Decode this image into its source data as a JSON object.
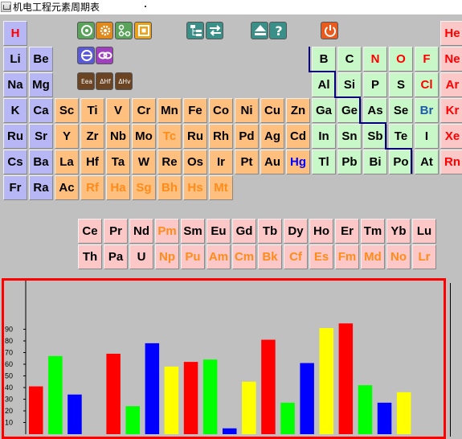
{
  "window": {
    "title": "机电工程元素周期表"
  },
  "toolbar": [
    {
      "name": "settings-button",
      "icon": "target-icon",
      "bg": "#5aa35a",
      "fg": "#ffffff"
    },
    {
      "name": "cycle-button",
      "icon": "cogs-icon",
      "bg": "#e08a1e",
      "fg": "#ffffff"
    },
    {
      "name": "network-button",
      "icon": "nodes-icon",
      "bg": "#5aa35a",
      "fg": "#ffffff"
    },
    {
      "name": "frame-button",
      "icon": "square-frame-icon",
      "bg": "#e8a21e",
      "fg": "#ffffff"
    },
    {
      "name": "layout-button",
      "icon": "tree-layout-icon",
      "bg": "#3a8f88",
      "fg": "#ffffff"
    },
    {
      "name": "swap-button",
      "icon": "swap-arrows-icon",
      "bg": "#3a8f88",
      "fg": "#ffffff"
    },
    {
      "name": "eject-button",
      "icon": "eject-icon",
      "bg": "#3a8f88",
      "fg": "#ffffff"
    },
    {
      "name": "help-button",
      "icon": "question-icon",
      "bg": "#3a8f88",
      "fg": "#ffffff"
    },
    {
      "name": "power-button",
      "icon": "power-icon",
      "bg": "#e85a1e",
      "fg": "#ffffff"
    },
    {
      "name": "refresh-button",
      "icon": "refresh-icon",
      "bg": "#5a5ad8",
      "fg": "#ffffff"
    },
    {
      "name": "link-button",
      "icon": "chain-link-icon",
      "bg": "#a040c0",
      "fg": "#ffffff"
    },
    {
      "name": "electron-affinity-button",
      "icon": "energy-icon",
      "bg": "#7a4a20",
      "fg": "#ffffff",
      "label": "Eea"
    },
    {
      "name": "delta-hf-button",
      "icon": "delta-h-icon",
      "bg": "#7a4a20",
      "fg": "#ffffff",
      "label": "ΔHf"
    },
    {
      "name": "delta-hv-button",
      "icon": "delta-h-icon",
      "bg": "#7a4a20",
      "fg": "#ffffff",
      "label": "ΔHv"
    }
  ],
  "elements": [
    {
      "symbol": "H",
      "bg": "blue",
      "color": "red"
    },
    {
      "symbol": "He",
      "bg": "pink",
      "color": "red"
    },
    {
      "symbol": "Li",
      "bg": "blue",
      "color": "black"
    },
    {
      "symbol": "Be",
      "bg": "blue",
      "color": "black"
    },
    {
      "symbol": "B",
      "bg": "green",
      "color": "black"
    },
    {
      "symbol": "C",
      "bg": "green",
      "color": "black"
    },
    {
      "symbol": "N",
      "bg": "green",
      "color": "red"
    },
    {
      "symbol": "O",
      "bg": "green",
      "color": "red"
    },
    {
      "symbol": "F",
      "bg": "green",
      "color": "red"
    },
    {
      "symbol": "Ne",
      "bg": "pink",
      "color": "red"
    },
    {
      "symbol": "Na",
      "bg": "blue",
      "color": "black"
    },
    {
      "symbol": "Mg",
      "bg": "blue",
      "color": "black"
    },
    {
      "symbol": "Al",
      "bg": "green",
      "color": "black"
    },
    {
      "symbol": "Si",
      "bg": "green",
      "color": "black"
    },
    {
      "symbol": "P",
      "bg": "green",
      "color": "black"
    },
    {
      "symbol": "S",
      "bg": "green",
      "color": "black"
    },
    {
      "symbol": "Cl",
      "bg": "green",
      "color": "red"
    },
    {
      "symbol": "Ar",
      "bg": "pink",
      "color": "red"
    },
    {
      "symbol": "K",
      "bg": "blue",
      "color": "black"
    },
    {
      "symbol": "Ca",
      "bg": "blue",
      "color": "black"
    },
    {
      "symbol": "Sc",
      "bg": "orange",
      "color": "black"
    },
    {
      "symbol": "Ti",
      "bg": "orange",
      "color": "black"
    },
    {
      "symbol": "V",
      "bg": "orange",
      "color": "black"
    },
    {
      "symbol": "Cr",
      "bg": "orange",
      "color": "black"
    },
    {
      "symbol": "Mn",
      "bg": "orange",
      "color": "black"
    },
    {
      "symbol": "Fe",
      "bg": "orange",
      "color": "black"
    },
    {
      "symbol": "Co",
      "bg": "orange",
      "color": "black"
    },
    {
      "symbol": "Ni",
      "bg": "orange",
      "color": "black"
    },
    {
      "symbol": "Cu",
      "bg": "orange",
      "color": "black"
    },
    {
      "symbol": "Zn",
      "bg": "orange",
      "color": "black"
    },
    {
      "symbol": "Ga",
      "bg": "green",
      "color": "black"
    },
    {
      "symbol": "Ge",
      "bg": "green",
      "color": "black"
    },
    {
      "symbol": "As",
      "bg": "green",
      "color": "black"
    },
    {
      "symbol": "Se",
      "bg": "green",
      "color": "black"
    },
    {
      "symbol": "Br",
      "bg": "green",
      "color": "navy"
    },
    {
      "symbol": "Kr",
      "bg": "pink",
      "color": "red"
    },
    {
      "symbol": "Ru",
      "bg": "blue",
      "color": "black"
    },
    {
      "symbol": "Sr",
      "bg": "blue",
      "color": "black"
    },
    {
      "symbol": "Y",
      "bg": "orange",
      "color": "black"
    },
    {
      "symbol": "Zr",
      "bg": "orange",
      "color": "black"
    },
    {
      "symbol": "Nb",
      "bg": "orange",
      "color": "black"
    },
    {
      "symbol": "Mo",
      "bg": "orange",
      "color": "black"
    },
    {
      "symbol": "Tc",
      "bg": "orange",
      "color": "orange"
    },
    {
      "symbol": "Ru",
      "bg": "orange",
      "color": "black"
    },
    {
      "symbol": "Rh",
      "bg": "orange",
      "color": "black"
    },
    {
      "symbol": "Pd",
      "bg": "orange",
      "color": "black"
    },
    {
      "symbol": "Ag",
      "bg": "orange",
      "color": "black"
    },
    {
      "symbol": "Cd",
      "bg": "orange",
      "color": "black"
    },
    {
      "symbol": "In",
      "bg": "green",
      "color": "black"
    },
    {
      "symbol": "Sn",
      "bg": "green",
      "color": "black"
    },
    {
      "symbol": "Sb",
      "bg": "green",
      "color": "black"
    },
    {
      "symbol": "Te",
      "bg": "green",
      "color": "black"
    },
    {
      "symbol": "I",
      "bg": "green",
      "color": "black"
    },
    {
      "symbol": "Xe",
      "bg": "pink",
      "color": "red"
    },
    {
      "symbol": "Cs",
      "bg": "blue",
      "color": "black"
    },
    {
      "symbol": "Ba",
      "bg": "blue",
      "color": "black"
    },
    {
      "symbol": "La",
      "bg": "orange",
      "color": "black"
    },
    {
      "symbol": "Hf",
      "bg": "orange",
      "color": "black"
    },
    {
      "symbol": "Ta",
      "bg": "orange",
      "color": "black"
    },
    {
      "symbol": "W",
      "bg": "orange",
      "color": "black"
    },
    {
      "symbol": "Re",
      "bg": "orange",
      "color": "black"
    },
    {
      "symbol": "Os",
      "bg": "orange",
      "color": "black"
    },
    {
      "symbol": "Ir",
      "bg": "orange",
      "color": "black"
    },
    {
      "symbol": "Pt",
      "bg": "orange",
      "color": "black"
    },
    {
      "symbol": "Au",
      "bg": "orange",
      "color": "black"
    },
    {
      "symbol": "Hg",
      "bg": "orange",
      "color": "blue"
    },
    {
      "symbol": "Tl",
      "bg": "green",
      "color": "black"
    },
    {
      "symbol": "Pb",
      "bg": "green",
      "color": "black"
    },
    {
      "symbol": "Bi",
      "bg": "green",
      "color": "black"
    },
    {
      "symbol": "Po",
      "bg": "green",
      "color": "black"
    },
    {
      "symbol": "At",
      "bg": "green",
      "color": "black"
    },
    {
      "symbol": "Rn",
      "bg": "pink",
      "color": "red"
    },
    {
      "symbol": "Fr",
      "bg": "blue",
      "color": "black"
    },
    {
      "symbol": "Ra",
      "bg": "blue",
      "color": "black"
    },
    {
      "symbol": "Ac",
      "bg": "orange",
      "color": "black"
    },
    {
      "symbol": "Rf",
      "bg": "orange",
      "color": "orange"
    },
    {
      "symbol": "Ha",
      "bg": "orange",
      "color": "orange"
    },
    {
      "symbol": "Sg",
      "bg": "orange",
      "color": "orange"
    },
    {
      "symbol": "Bh",
      "bg": "orange",
      "color": "orange"
    },
    {
      "symbol": "Hs",
      "bg": "orange",
      "color": "orange"
    },
    {
      "symbol": "Mt",
      "bg": "orange",
      "color": "orange"
    }
  ],
  "f_block": [
    {
      "symbol": "Ce",
      "bg": "pink",
      "color": "black"
    },
    {
      "symbol": "Pr",
      "bg": "pink",
      "color": "black"
    },
    {
      "symbol": "Nd",
      "bg": "pink",
      "color": "black"
    },
    {
      "symbol": "Pm",
      "bg": "pink",
      "color": "orange"
    },
    {
      "symbol": "Sm",
      "bg": "pink",
      "color": "black"
    },
    {
      "symbol": "Eu",
      "bg": "pink",
      "color": "black"
    },
    {
      "symbol": "Gd",
      "bg": "pink",
      "color": "black"
    },
    {
      "symbol": "Tb",
      "bg": "pink",
      "color": "black"
    },
    {
      "symbol": "Dy",
      "bg": "pink",
      "color": "black"
    },
    {
      "symbol": "Ho",
      "bg": "pink",
      "color": "black"
    },
    {
      "symbol": "Er",
      "bg": "pink",
      "color": "black"
    },
    {
      "symbol": "Tm",
      "bg": "pink",
      "color": "black"
    },
    {
      "symbol": "Yb",
      "bg": "pink",
      "color": "black"
    },
    {
      "symbol": "Lu",
      "bg": "pink",
      "color": "black"
    },
    {
      "symbol": "Th",
      "bg": "pink",
      "color": "black"
    },
    {
      "symbol": "Pa",
      "bg": "pink",
      "color": "black"
    },
    {
      "symbol": "U",
      "bg": "pink",
      "color": "black"
    },
    {
      "symbol": "Np",
      "bg": "pink",
      "color": "orange"
    },
    {
      "symbol": "Pu",
      "bg": "pink",
      "color": "orange"
    },
    {
      "symbol": "Am",
      "bg": "pink",
      "color": "orange"
    },
    {
      "symbol": "Cm",
      "bg": "pink",
      "color": "orange"
    },
    {
      "symbol": "Bk",
      "bg": "pink",
      "color": "orange"
    },
    {
      "symbol": "Cf",
      "bg": "pink",
      "color": "orange"
    },
    {
      "symbol": "Es",
      "bg": "pink",
      "color": "orange"
    },
    {
      "symbol": "Fm",
      "bg": "pink",
      "color": "orange"
    },
    {
      "symbol": "Md",
      "bg": "pink",
      "color": "orange"
    },
    {
      "symbol": "No",
      "bg": "pink",
      "color": "orange"
    },
    {
      "symbol": "Lr",
      "bg": "pink",
      "color": "orange"
    }
  ],
  "chart_data": {
    "type": "bar",
    "title": "",
    "xlabel": "",
    "ylabel": "",
    "ylim": [
      0,
      100
    ],
    "yticks": [
      "10",
      "20",
      "30",
      "40",
      "50",
      "60",
      "70",
      "80",
      "90"
    ],
    "legend": "none",
    "grid": false,
    "values": [
      41,
      67,
      34,
      0,
      69,
      24,
      78,
      58,
      62,
      64,
      5,
      45,
      81,
      27,
      61,
      91,
      95,
      42,
      27,
      36
    ],
    "colors": [
      "#ff0000",
      "#00ff00",
      "#0000ff",
      "#ffff00",
      "#ff0000",
      "#00ff00",
      "#0000ff",
      "#ffff00",
      "#ff0000",
      "#00ff00",
      "#0000ff",
      "#ffff00",
      "#ff0000",
      "#00ff00",
      "#0000ff",
      "#ffff00",
      "#ff0000",
      "#00ff00",
      "#0000ff",
      "#ffff00"
    ]
  }
}
